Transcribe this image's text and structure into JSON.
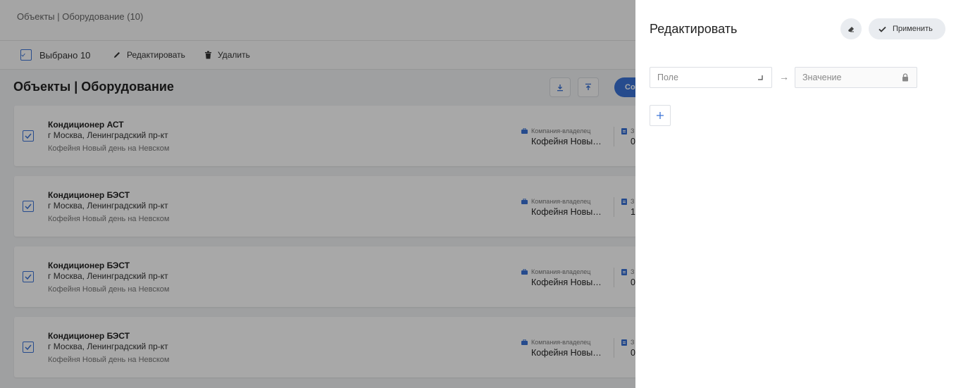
{
  "breadcrumb": "Объекты | Оборудование (10)",
  "toolbar": {
    "selected_label": "Выбрано 10",
    "edit_label": "Редактировать",
    "delete_label": "Удалить"
  },
  "page": {
    "title": "Объекты | Оборудование",
    "create_label": "Со"
  },
  "cards": [
    {
      "name": "Кондиционер АСТ",
      "address": "г Москва, Ленинградский пр-кт",
      "org": "Кофейня Новый день на Невском",
      "owner_label": "Компания-владелец",
      "owner_value": "Кофейня Новый день на Невском",
      "col2_label": "З",
      "col2_value": "0"
    },
    {
      "name": "Кондиционер БЭСТ",
      "address": "г Москва, Ленинградский пр-кт",
      "org": "Кофейня Новый день на Невском",
      "owner_label": "Компания-владелец",
      "owner_value": "Кофейня Новый день на Невском",
      "col2_label": "З",
      "col2_value": "1"
    },
    {
      "name": "Кондиционер БЭСТ",
      "address": "г Москва, Ленинградский пр-кт",
      "org": "Кофейня Новый день на Невском",
      "owner_label": "Компания-владелец",
      "owner_value": "Кофейня Новый день на Невском",
      "col2_label": "З",
      "col2_value": "0"
    },
    {
      "name": "Кондиционер БЭСТ",
      "address": "г Москва, Ленинградский пр-кт",
      "org": "Кофейня Новый день на Невском",
      "owner_label": "Компания-владелец",
      "owner_value": "Кофейня Новый день на Невском",
      "col2_label": "З",
      "col2_value": "0"
    }
  ],
  "panel": {
    "title": "Редактировать",
    "apply_label": "Применить",
    "field_placeholder": "Поле",
    "value_placeholder": "Значение",
    "arrow": "→"
  },
  "colors": {
    "accent": "#3b73d6",
    "overlay": "rgba(0,0,0,0.34)"
  },
  "icons": {
    "checkbox": "check-icon",
    "edit": "pencil-icon",
    "delete": "trash-icon",
    "download": "download-icon",
    "upload": "upload-icon",
    "owner": "briefcase-icon",
    "eraser": "eraser-icon",
    "apply": "check-icon",
    "dropdown": "corner-arrow-icon",
    "lock": "lock-icon",
    "add": "plus-icon"
  }
}
